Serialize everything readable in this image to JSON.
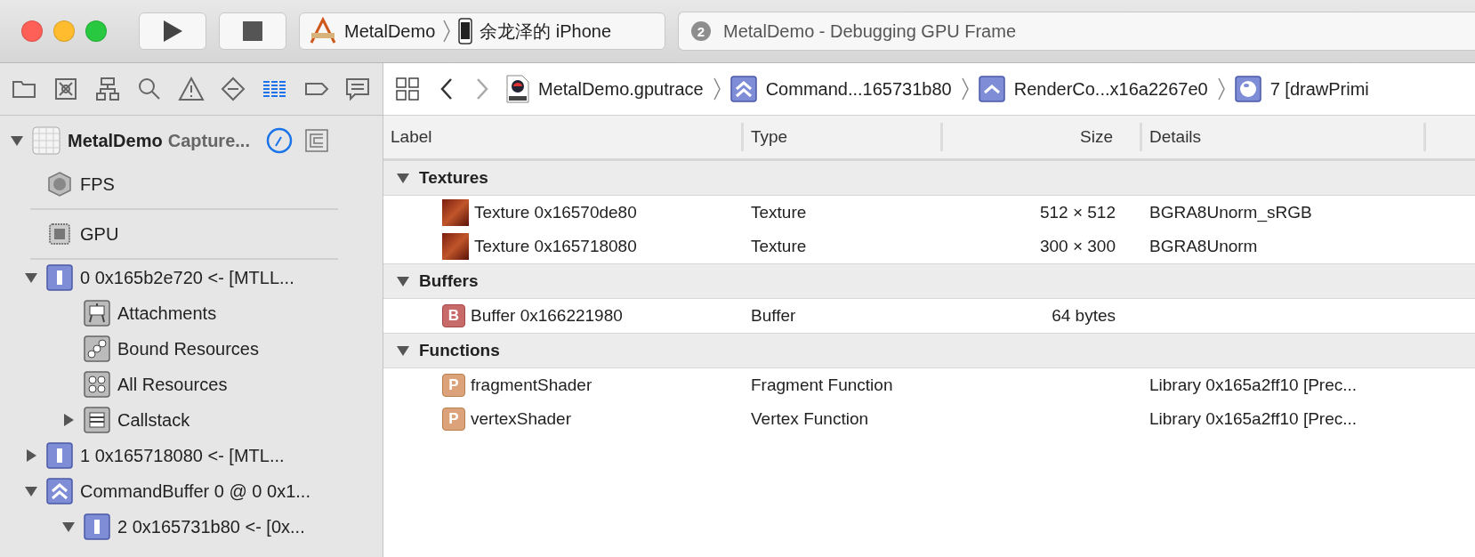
{
  "toolbar": {
    "scheme": {
      "project": "MetalDemo",
      "device": "余龙泽的 iPhone"
    },
    "activity": {
      "count": "2",
      "text": "MetalDemo - Debugging GPU Frame"
    }
  },
  "navigator_tabs": [
    {
      "kind": "folder",
      "selected": false
    },
    {
      "kind": "source",
      "selected": false
    },
    {
      "kind": "hierarchy",
      "selected": false
    },
    {
      "kind": "search",
      "selected": false
    },
    {
      "kind": "warning",
      "selected": false
    },
    {
      "kind": "test",
      "selected": false
    },
    {
      "kind": "debug",
      "selected": true
    },
    {
      "kind": "breakpoint",
      "selected": false
    },
    {
      "kind": "report",
      "selected": false
    }
  ],
  "sidebar": {
    "root": {
      "title": "MetalDemo",
      "subtitle": "Capture...",
      "expanded": true
    },
    "items": [
      {
        "kind": "fps",
        "label": "FPS"
      },
      {
        "kind": "gpu",
        "label": "GPU"
      },
      {
        "kind": "encoder",
        "label": "0 0x165b2e720 <- [MTLL...",
        "expanded": true,
        "children": [
          {
            "kind": "attachments",
            "label": "Attachments"
          },
          {
            "kind": "bound",
            "label": "Bound Resources"
          },
          {
            "kind": "all",
            "label": "All Resources"
          },
          {
            "kind": "callstack",
            "label": "Callstack",
            "expanded": false
          }
        ]
      },
      {
        "kind": "encoder",
        "label": "1 0x165718080 <- [MTL...",
        "expanded": false
      },
      {
        "kind": "command-buffer",
        "label": "CommandBuffer 0 @ 0 0x1...",
        "expanded": true,
        "children": [
          {
            "kind": "encoder",
            "label": "2 0x165731b80 <- [0x...",
            "expanded": true
          }
        ]
      }
    ]
  },
  "breadcrumbs": [
    {
      "kind": "trace",
      "label": "MetalDemo.gputrace"
    },
    {
      "kind": "command-buffer",
      "label": "Command...165731b80"
    },
    {
      "kind": "render",
      "label": "RenderCo...x16a2267e0"
    },
    {
      "kind": "draw",
      "label": "7 [drawPrimi"
    }
  ],
  "table": {
    "columns": [
      "Label",
      "Type",
      "Size",
      "Details"
    ],
    "groups": [
      {
        "title": "Textures",
        "expanded": true,
        "rows": [
          {
            "kind": "texture",
            "label": "Texture 0x16570de80",
            "type": "Texture",
            "size": "512 × 512",
            "details": "BGRA8Unorm_sRGB"
          },
          {
            "kind": "texture",
            "label": "Texture 0x165718080",
            "type": "Texture",
            "size": "300 × 300",
            "details": "BGRA8Unorm"
          }
        ]
      },
      {
        "title": "Buffers",
        "expanded": true,
        "rows": [
          {
            "kind": "buffer",
            "badge": "B",
            "label": "Buffer 0x166221980",
            "type": "Buffer",
            "size": "64 bytes"
          }
        ]
      },
      {
        "title": "Functions",
        "expanded": true,
        "rows": [
          {
            "kind": "function",
            "badge": "P",
            "label": "fragmentShader",
            "type": "Fragment Function",
            "details": "Library 0x165a2ff10 [Prec..."
          },
          {
            "kind": "function",
            "badge": "P",
            "label": "vertexShader",
            "type": "Vertex Function",
            "details": "Library 0x165a2ff10 [Prec..."
          }
        ]
      }
    ]
  }
}
